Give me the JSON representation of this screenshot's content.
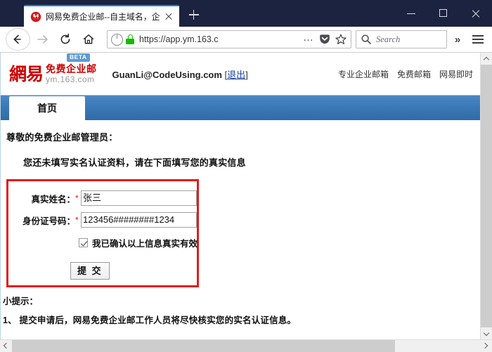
{
  "browser": {
    "tab": {
      "title": "网易免费企业邮--自主域名，企",
      "favicon_name": "netease-mail-favicon",
      "close_label": "×"
    },
    "newtab_label": "+",
    "window_controls": {
      "minimize": "—",
      "maximize": "□",
      "close": "✕"
    },
    "nav": {
      "back": "back-arrow",
      "forward": "forward-arrow",
      "reload": "reload-arrow",
      "home": "home-house"
    },
    "url": "https://app.ym.163.c",
    "url_identity": "site-information",
    "url_secure": "secure-lock",
    "page_actions": "…",
    "search": {
      "placeholder": "Search"
    },
    "overflow": "»",
    "menu": "hamburger-menu"
  },
  "site": {
    "logo": {
      "brand_cn": "網易",
      "product": "免费企业邮",
      "domain": "ym.163.com",
      "badge": "BETA",
      "brand_color": "#cc0000"
    },
    "account": {
      "email": "GuanLi@CodeUsing.com",
      "bracket_open": "[",
      "logout": "退出",
      "bracket_close": "]"
    },
    "header_links": [
      {
        "label": "专业企业邮箱"
      },
      {
        "label": "免费邮箱"
      },
      {
        "label": "网易即时"
      }
    ],
    "tabs": [
      {
        "label": "首页",
        "active": true
      }
    ],
    "content": {
      "greeting": "尊敬的免费企业邮管理员：",
      "subnote": "您还未填写实名认证资料，请在下面填写您的真实信息",
      "form": {
        "border_color": "#e21b1b",
        "required_mark": "*",
        "fields": [
          {
            "label": "真实姓名：",
            "value": "张三"
          },
          {
            "label": "身份证号码：",
            "value": "123456########1234"
          }
        ],
        "checkbox": {
          "label": "我已确认以上信息真实有效",
          "checked": true
        },
        "submit_label": "提 交"
      },
      "tips_title": "小提示：",
      "tips": [
        {
          "text": "1、 提交申请后，网易免费企业邮工作人员将尽快核实您的实名认证信息。"
        }
      ]
    }
  }
}
